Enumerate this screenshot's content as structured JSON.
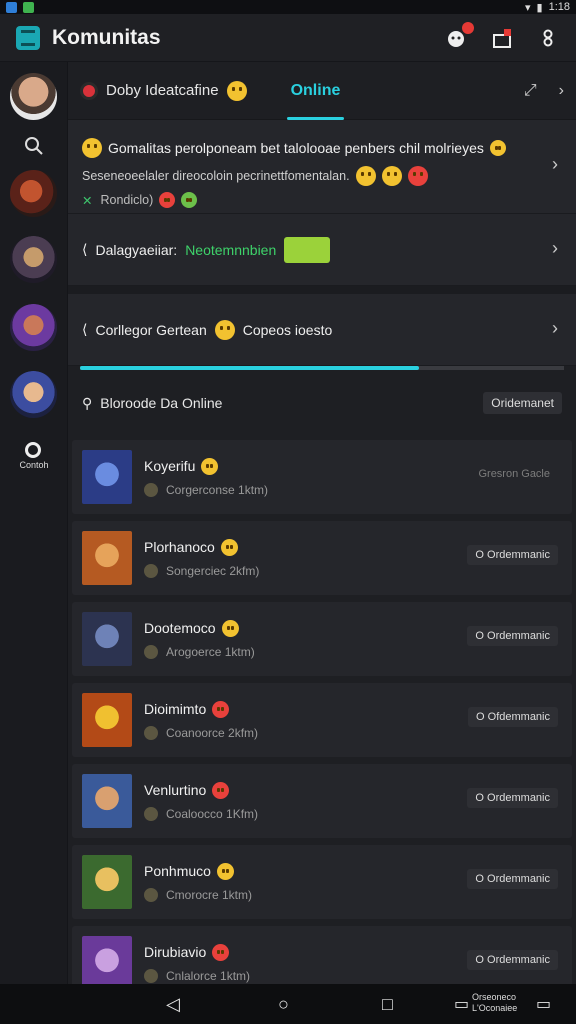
{
  "status_bar": {
    "time": "1:18"
  },
  "app_bar": {
    "title": "Komunitas",
    "icons": [
      "notification-icon",
      "gift-icon",
      "settings-icon"
    ]
  },
  "rail": {
    "search_icon": "search-icon",
    "bottom_label": "Contoh"
  },
  "tabs": {
    "first_label": "Doby Ideatcafine",
    "second_label": "Online"
  },
  "card_a": {
    "line1": "Gomalitas perolponeam bet talolooae penbers chil molrieyes",
    "line2": "Seseneoeelaler direocoloin pecrinettfomentalan.",
    "line3": "Rondiclo)"
  },
  "card_b": {
    "label": "Dalagyaeiiar:",
    "green_label": "Neotemnnbien"
  },
  "card_c": {
    "label": "Corllegor Gertean",
    "label2": "Copeos ioesto",
    "progress": 0.7
  },
  "section": {
    "title": "Bloroode Da Online",
    "chip": "Oridemanet"
  },
  "items": [
    {
      "name": "Koyerifu",
      "sub": "Corgerconse 1ktm)",
      "status": "Gresron Gacle",
      "status_plain": true,
      "emoji": "yellow"
    },
    {
      "name": "Plorhanoco",
      "sub": "Songerciec 2kfm)",
      "status": "O Ordemmanic",
      "status_plain": false,
      "emoji": "yellow"
    },
    {
      "name": "Dootemoco",
      "sub": "Arogoerce 1ktm)",
      "status": "O Ordemmanic",
      "status_plain": false,
      "emoji": "yellow"
    },
    {
      "name": "Dioimimto",
      "sub": "Coanoorce 2kfm)",
      "status": "O Ofdemmanic",
      "status_plain": false,
      "emoji": "red"
    },
    {
      "name": "Venlurtino",
      "sub": "Coaloocco 1Kfm)",
      "status": "O Ordemmanic",
      "status_plain": false,
      "emoji": "red"
    },
    {
      "name": "Ponhmuco",
      "sub": "Cmorocre 1ktm)",
      "status": "O Ordemmanic",
      "status_plain": false,
      "emoji": "yellow"
    },
    {
      "name": "Dirubiavio",
      "sub": "Cnlalorce 1ktm)",
      "status": "O Ordemmanic",
      "status_plain": false,
      "emoji": "red"
    }
  ],
  "nav_bar": {
    "note_line1": "Orseoneco",
    "note_line2": "L'Oconaiee"
  }
}
